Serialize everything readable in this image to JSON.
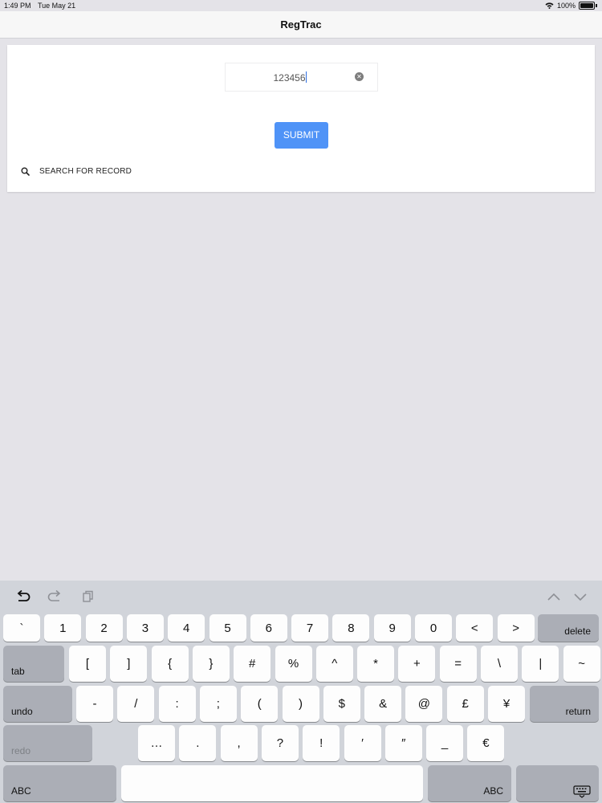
{
  "status_bar": {
    "time": "1:49 PM",
    "date": "Tue May 21",
    "battery": "100%"
  },
  "nav": {
    "title": "RegTrac"
  },
  "form": {
    "input_value": "123456",
    "submit_label": "SUBMIT",
    "search_label": "SEARCH FOR RECORD"
  },
  "keyboard": {
    "row1": [
      "`",
      "1",
      "2",
      "3",
      "4",
      "5",
      "6",
      "7",
      "8",
      "9",
      "0",
      "<",
      ">"
    ],
    "delete_label": "delete",
    "tab_label": "tab",
    "row2": [
      "[",
      "]",
      "{",
      "}",
      "#",
      "%",
      "^",
      "*",
      "+",
      "=",
      "\\",
      "|",
      "~"
    ],
    "undo_label": "undo",
    "row3": [
      "-",
      "/",
      ":",
      ";",
      "(",
      ")",
      "$",
      "&",
      "@",
      "£",
      "¥"
    ],
    "return_label": "return",
    "redo_label": "redo",
    "row4": [
      "…",
      ".",
      ",",
      "?",
      "!",
      "′",
      "″",
      "_",
      "€"
    ],
    "abc_label": "ABC",
    "abc_right_label": "ABC"
  }
}
